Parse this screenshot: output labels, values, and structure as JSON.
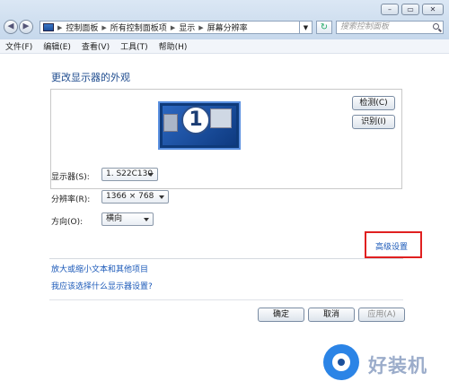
{
  "window": {
    "min_glyph": "–",
    "max_glyph": "▭",
    "close_glyph": "✕"
  },
  "address_bar": {
    "crumbs": [
      "控制面板",
      "所有控制面板项",
      "显示",
      "屏幕分辨率"
    ],
    "search_placeholder": "搜索控制面板"
  },
  "menu": [
    "文件(F)",
    "编辑(E)",
    "查看(V)",
    "工具(T)",
    "帮助(H)"
  ],
  "page": {
    "heading": "更改显示器的外观",
    "detect_label": "检测(C)",
    "identify_label": "识别(I)",
    "monitor_number": "1",
    "display_label": "显示器(S):",
    "display_value": "1. S22C130",
    "resolution_label": "分辨率(R):",
    "resolution_value": "1366 × 768",
    "orientation_label": "方向(O):",
    "orientation_value": "横向",
    "advanced_link": "高级设置",
    "link_text_size": "放大或缩小文本和其他项目",
    "link_which_settings": "我应该选择什么显示器设置?",
    "ok_label": "确定",
    "cancel_label": "取消",
    "apply_label": "应用(A)"
  },
  "watermark": "好装机",
  "colors": {
    "highlight_box": "#e02020",
    "link": "#1a58b8",
    "heading": "#1e4b8e"
  }
}
